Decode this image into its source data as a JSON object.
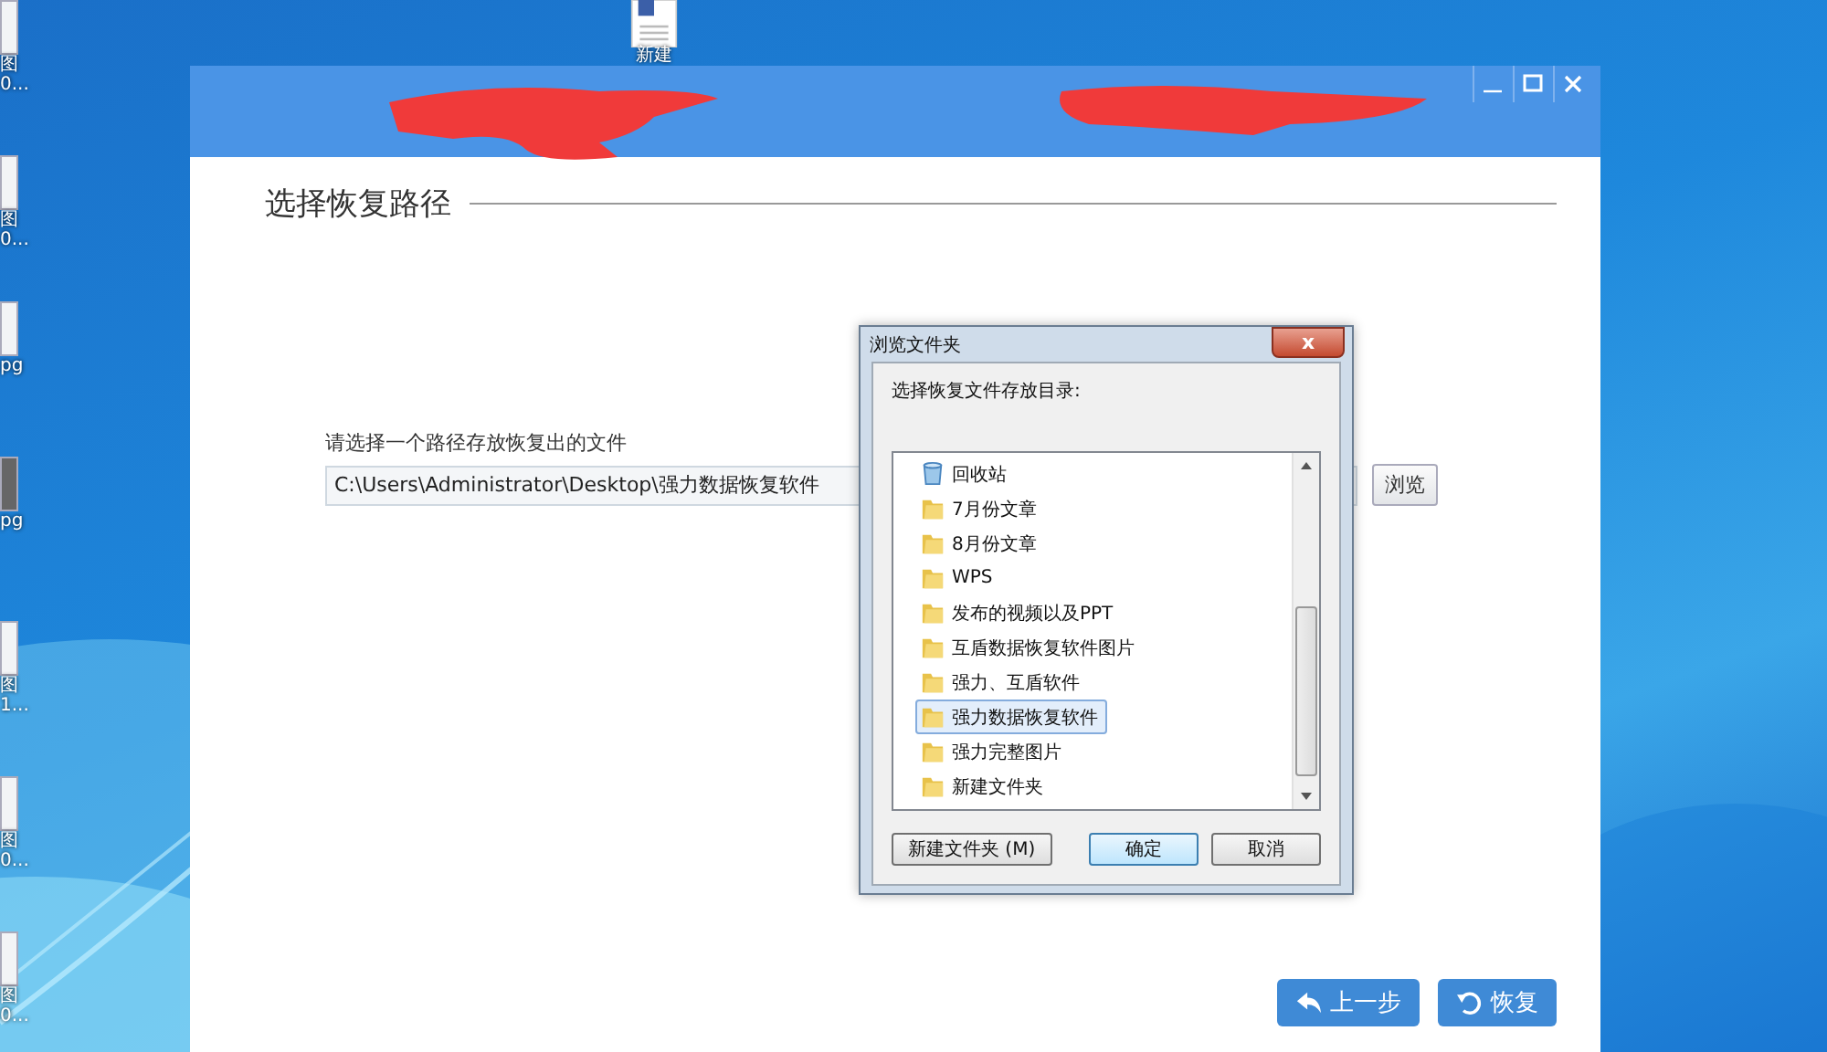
{
  "desktop_icons": [
    {
      "kind": "doc",
      "lines": [
        "图",
        "0..."
      ]
    },
    {
      "kind": "doc",
      "lines": [
        "图",
        "0..."
      ]
    },
    {
      "kind": "doc",
      "lines": [
        "pg"
      ]
    },
    {
      "lines": [
        "pg"
      ]
    },
    {
      "kind": "doc",
      "lines": [
        "图",
        "1..."
      ]
    },
    {
      "kind": "doc",
      "lines": [
        "图",
        "0..."
      ]
    },
    {
      "kind": "doc",
      "lines": [
        "图",
        "0..."
      ]
    }
  ],
  "top_icon": {
    "label": "新建"
  },
  "window": {
    "heading": "选择恢复路径",
    "path_label": "请选择一个路径存放恢复出的文件",
    "path_value": "C:\\Users\\Administrator\\Desktop\\强力数据恢复软件",
    "browse_button": "浏览",
    "back_button": "上一步",
    "recover_button": "恢复"
  },
  "dialog": {
    "title": "浏览文件夹",
    "close": "x",
    "prompt": "选择恢复文件存放目录:",
    "folders": [
      {
        "kind": "recycle",
        "name": "回收站",
        "selected": false
      },
      {
        "kind": "folder",
        "name": "7月份文章",
        "selected": false
      },
      {
        "kind": "folder",
        "name": "8月份文章",
        "selected": false
      },
      {
        "kind": "folder",
        "name": "WPS",
        "selected": false
      },
      {
        "kind": "folder",
        "name": "发布的视频以及PPT",
        "selected": false
      },
      {
        "kind": "folder",
        "name": "互盾数据恢复软件图片",
        "selected": false
      },
      {
        "kind": "folder",
        "name": "强力、互盾软件",
        "selected": false
      },
      {
        "kind": "folder",
        "name": "强力数据恢复软件",
        "selected": true
      },
      {
        "kind": "folder",
        "name": "强力完整图片",
        "selected": false
      },
      {
        "kind": "folder",
        "name": "新建文件夹",
        "selected": false
      }
    ],
    "new_folder_button": "新建文件夹 (M)",
    "ok_button": "确定",
    "cancel_button": "取消"
  }
}
